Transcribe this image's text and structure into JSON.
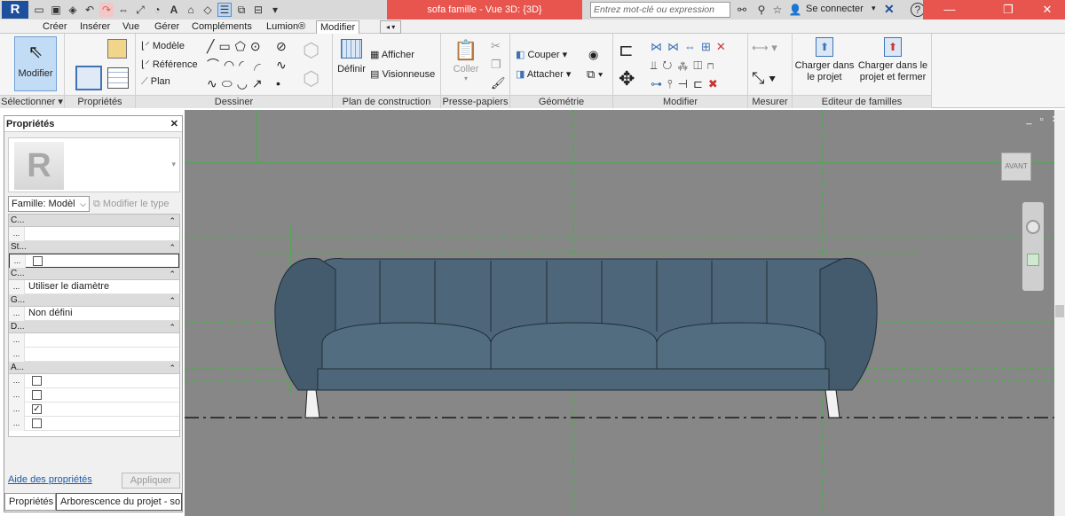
{
  "app": {
    "logo_letter": "R",
    "document_title": "sofa famille - Vue 3D: {3D}",
    "search_placeholder": "Entrez mot-clé ou expression",
    "sign_in": "Se connecter"
  },
  "menu_tabs": [
    "Créer",
    "Insérer",
    "Vue",
    "Gérer",
    "Compléments",
    "Lumion®",
    "Modifier"
  ],
  "active_tab": "Modifier",
  "ribbon": {
    "select_panel": {
      "button": "Modifier",
      "label": "Sélectionner ▾"
    },
    "properties_panel": {
      "label": "Propriétés"
    },
    "draw_panel": {
      "label": "Dessiner",
      "items": [
        "Modèle",
        "Référence",
        "Plan"
      ]
    },
    "workplane_panel": {
      "label": "Plan de construction",
      "define": "Définir",
      "show": "Afficher",
      "viewer": "Visionneuse"
    },
    "clipboard_panel": {
      "label": "Presse-papiers",
      "paste": "Coller"
    },
    "geometry_panel": {
      "label": "Géométrie",
      "cut": "Couper",
      "join": "Attacher"
    },
    "modify_panel": {
      "label": "Modifier"
    },
    "measure_panel": {
      "label": "Mesurer"
    },
    "family_editor_panel": {
      "label": "Editeur de familles",
      "load_into_project": "Charger dans le projet",
      "load_and_close": "Charger dans le projet et fermer"
    }
  },
  "properties": {
    "title": "Propriétés",
    "family_selector": "Famille: Modèl",
    "edit_type": "Modifier le type",
    "groups": [
      {
        "label": "C...",
        "rows": [
          {
            "dots": "...",
            "value": "",
            "checkbox": null
          }
        ]
      },
      {
        "label": "St...",
        "rows": [
          {
            "dots": "...",
            "value": "",
            "checkbox": false
          }
        ]
      },
      {
        "label": "C...",
        "rows": [
          {
            "dots": "...",
            "value": "Utiliser le diamètre",
            "checkbox": null
          }
        ]
      },
      {
        "label": "G...",
        "rows": [
          {
            "dots": "...",
            "value": "Non défini",
            "checkbox": null
          }
        ]
      },
      {
        "label": "D...",
        "rows": [
          {
            "dots": "...",
            "value": "",
            "checkbox": null
          },
          {
            "dots": "...",
            "value": "",
            "checkbox": null
          }
        ]
      },
      {
        "label": "A...",
        "rows": [
          {
            "dots": "...",
            "value": "",
            "checkbox": false
          },
          {
            "dots": "...",
            "value": "",
            "checkbox": false
          },
          {
            "dots": "...",
            "value": "",
            "checkbox": true
          },
          {
            "dots": "...",
            "value": "",
            "checkbox": false
          }
        ]
      }
    ],
    "help_link": "Aide des propriétés",
    "apply": "Appliquer"
  },
  "bottom_tabs": [
    "Propriétés",
    "Arborescence du projet - so..."
  ],
  "viewport": {
    "viewcube_label": "AVANT"
  },
  "colors": {
    "title_accent": "#e8554e",
    "viewport_bg": "#878787",
    "sofa": "#4d6679",
    "ref_green": "#28c328"
  }
}
